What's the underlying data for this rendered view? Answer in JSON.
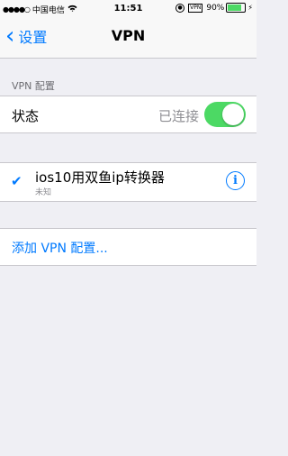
{
  "status_bar": {
    "signal_dots": "●●●●○",
    "carrier": "中国电信",
    "wifi_icon": "wifi-icon",
    "time": "11:51",
    "vpn_badge": "VPN",
    "battery_percent": "90%",
    "battery_level": 0.9
  },
  "nav": {
    "back_label": "设置",
    "title": "VPN"
  },
  "section": {
    "header": "VPN 配置"
  },
  "status_row": {
    "label": "状态",
    "value": "已连接",
    "toggle_on": true
  },
  "vpn_item": {
    "name": "ios10用双鱼ip转换器",
    "subtitle": "未知",
    "selected": true
  },
  "add_row": {
    "label": "添加 VPN 配置..."
  },
  "colors": {
    "accent": "#007aff",
    "toggle_on": "#4cd964",
    "background": "#efeff4"
  }
}
